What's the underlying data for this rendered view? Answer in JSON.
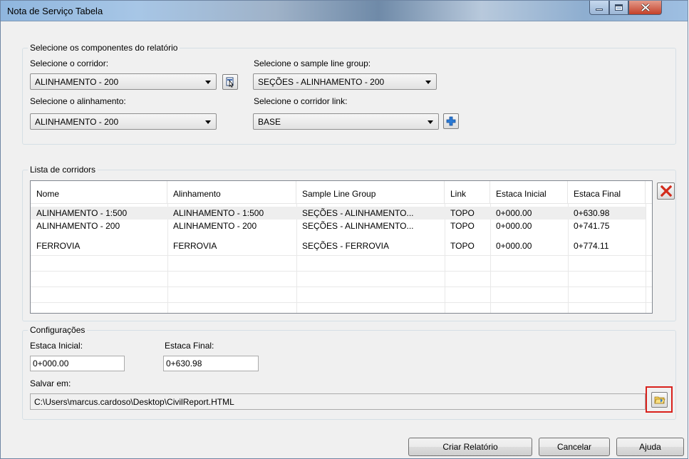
{
  "window": {
    "title": "Nota de Serviço Tabela"
  },
  "components_group": {
    "legend": "Selecione os componentes do relatório",
    "corridor_label": "Selecione o corridor:",
    "corridor_value": "ALINHAMENTO - 200",
    "sample_group_label": "Selecione o sample line group:",
    "sample_group_value": "SEÇÕES - ALINHAMENTO - 200",
    "alignment_label": "Selecione o alinhamento:",
    "alignment_value": "ALINHAMENTO - 200",
    "corridor_link_label": "Selecione o corridor link:",
    "corridor_link_value": "BASE"
  },
  "corridors_group": {
    "legend": "Lista de corridors",
    "columns": [
      "Nome",
      "Alinhamento",
      "Sample Line Group",
      "Link",
      "Estaca Inicial",
      "Estaca Final"
    ],
    "rows": [
      [
        "ALINHAMENTO - 1:500",
        "ALINHAMENTO - 1:500",
        "SEÇÕES - ALINHAMENTO...",
        "TOPO",
        "0+000.00",
        "0+630.98"
      ],
      [
        "ALINHAMENTO - 200",
        "ALINHAMENTO - 200",
        "SEÇÕES - ALINHAMENTO...",
        "TOPO",
        "0+000.00",
        "0+741.75"
      ],
      [
        "FERROVIA",
        "FERROVIA",
        "SEÇÕES - FERROVIA",
        "TOPO",
        "0+000.00",
        "0+774.11"
      ]
    ]
  },
  "settings_group": {
    "legend": "Configurações",
    "start_label": "Estaca Inicial:",
    "start_value": "0+000.00",
    "end_label": "Estaca Final:",
    "end_value": "0+630.98",
    "save_label": "Salvar em:",
    "save_path": "C:\\Users\\marcus.cardoso\\Desktop\\CivilReport.HTML"
  },
  "buttons": {
    "create": "Criar Relatório",
    "cancel": "Cancelar",
    "help": "Ajuda"
  },
  "colors": {
    "delete_icon": "#d22b1b",
    "add_icon": "#2b7bd6",
    "highlight": "#d9211c"
  }
}
